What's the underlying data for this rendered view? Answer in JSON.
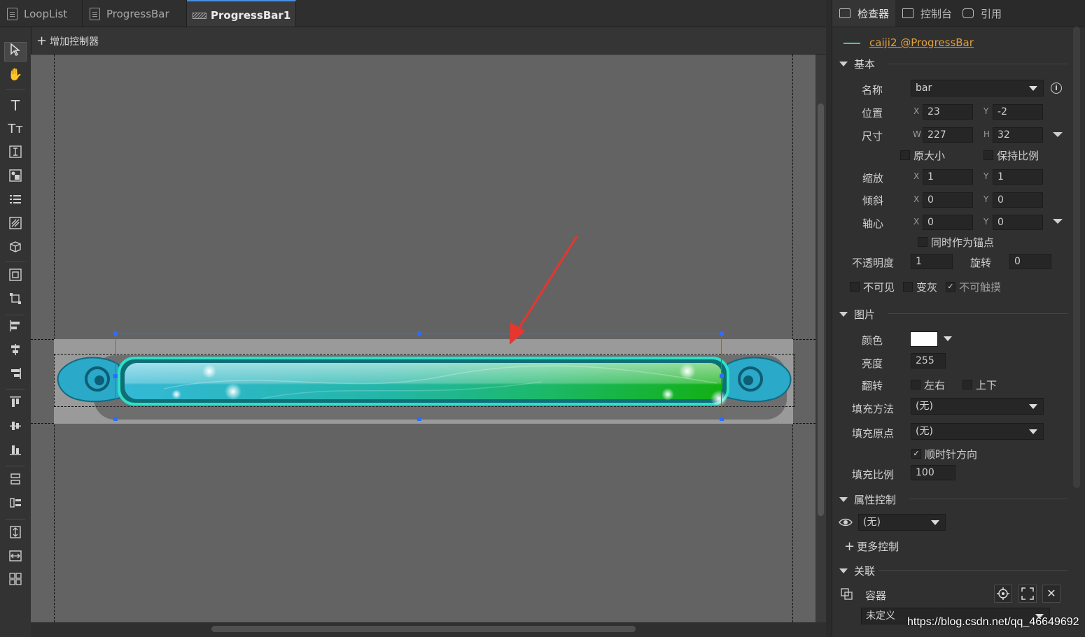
{
  "tabs": [
    {
      "label": "LoopList"
    },
    {
      "label": "ProgressBar"
    },
    {
      "label": "ProgressBar1",
      "modified": true
    }
  ],
  "toolbar": {
    "add_control_label": "增加控制器"
  },
  "left_tools": [
    "pointer-icon",
    "hand-icon",
    "text-icon",
    "rich-text-icon",
    "input-text-icon",
    "image-loader-icon",
    "list-icon",
    "progress-icon",
    "3d-icon",
    "group-icon",
    "transform-icon",
    "align-left-icon",
    "align-hcenter-icon",
    "align-right-icon",
    "align-top-icon",
    "align-vcenter-icon",
    "align-bottom-icon",
    "distribute-v-icon",
    "distribute-h-icon",
    "same-height-icon",
    "same-width-icon",
    "grid-icon"
  ],
  "inspector": {
    "tabs": [
      {
        "label": "检查器",
        "icon": "inspector-icon"
      },
      {
        "label": "控制台",
        "icon": "console-icon"
      },
      {
        "label": "引用",
        "icon": "reference-icon"
      }
    ],
    "object_link": "caiji2 @ProgressBar",
    "basic": {
      "title": "基本",
      "name_label": "名称",
      "name_value": "bar",
      "position_label": "位置",
      "x": "23",
      "y": "-2",
      "size_label": "尺寸",
      "w": "227",
      "h": "32",
      "original_size_label": "原大小",
      "keep_ratio_label": "保持比例",
      "scale_label": "缩放",
      "scale_x": "1",
      "scale_y": "1",
      "skew_label": "倾斜",
      "skew_x": "0",
      "skew_y": "0",
      "pivot_label": "轴心",
      "pivot_x": "0",
      "pivot_y": "0",
      "pivot_anchor_label": "同时作为锚点",
      "opacity_label": "不透明度",
      "opacity_value": "1",
      "rotation_label": "旋转",
      "rotation_value": "0",
      "invisible_label": "不可见",
      "grayed_label": "变灰",
      "untouchable_label": "不可触摸",
      "untouchable_checked": true
    },
    "image": {
      "title": "图片",
      "color_label": "颜色",
      "color_value": "#ffffff",
      "brightness_label": "亮度",
      "brightness_value": "255",
      "flip_label": "翻转",
      "flip_lr_label": "左右",
      "flip_ud_label": "上下",
      "fill_method_label": "填充方法",
      "fill_method_value": "(无)",
      "fill_origin_label": "填充原点",
      "fill_origin_value": "(无)",
      "clockwise_label": "顺时针方向",
      "clockwise_checked": true,
      "fill_ratio_label": "填充比例",
      "fill_ratio_value": "100"
    },
    "property_control": {
      "title": "属性控制",
      "value": "(无)",
      "more_label": "更多控制"
    },
    "relation": {
      "title": "关联",
      "container_label": "容器",
      "container_value": "未定义"
    }
  },
  "watermark": "https://blog.csdn.net/qq_46649692"
}
